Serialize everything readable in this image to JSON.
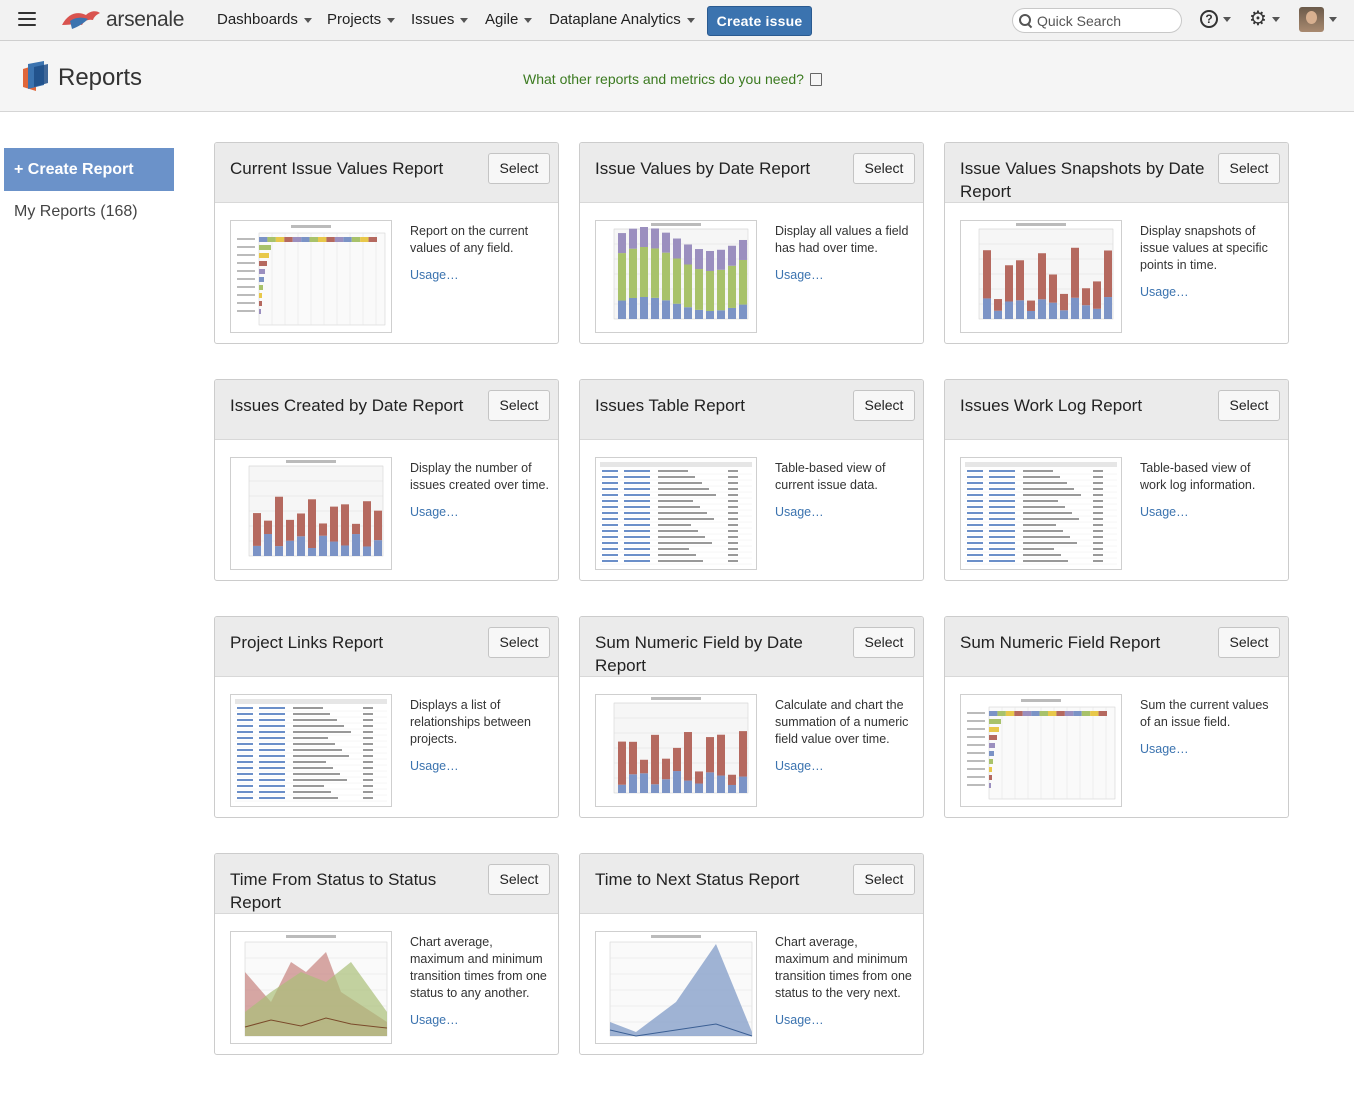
{
  "nav": {
    "brand": "arsenale",
    "items": [
      {
        "label": "Dashboards"
      },
      {
        "label": "Projects"
      },
      {
        "label": "Issues"
      },
      {
        "label": "Agile"
      },
      {
        "label": "Dataplane Analytics"
      }
    ],
    "create_issue": "Create issue",
    "search_placeholder": "Quick Search",
    "help_glyph": "?",
    "gear_glyph": "⚙"
  },
  "header": {
    "title": "Reports",
    "feedback": "What other reports and metrics do you need?"
  },
  "sidebar": {
    "create_report": "+ Create Report",
    "my_reports": "My Reports (168)"
  },
  "cards": [
    {
      "title": "Current Issue Values Report",
      "select": "Select",
      "desc": "Report on the current values of any field.",
      "usage": "Usage…",
      "thumb": "hbar-chart"
    },
    {
      "title": "Issue Values by Date Report",
      "select": "Select",
      "desc": "Display all values a field has had over time.",
      "usage": "Usage…",
      "thumb": "stacked-bar-chart"
    },
    {
      "title": "Issue Values Snapshots by Date Report",
      "select": "Select",
      "desc": "Display snapshots of issue values at specific points in time.",
      "usage": "Usage…",
      "thumb": "stacked-bar-chart"
    },
    {
      "title": "Issues Created by Date Report",
      "select": "Select",
      "desc": "Display the number of issues created over time.",
      "usage": "Usage…",
      "thumb": "stacked-bar-chart"
    },
    {
      "title": "Issues Table Report",
      "select": "Select",
      "desc": "Table-based view of current issue data.",
      "usage": "Usage…",
      "thumb": "table"
    },
    {
      "title": "Issues Work Log Report",
      "select": "Select",
      "desc": "Table-based view of work log information.",
      "usage": "Usage…",
      "thumb": "table"
    },
    {
      "title": "Project Links Report",
      "select": "Select",
      "desc": "Displays a list of relationships between projects.",
      "usage": "Usage…",
      "thumb": "table"
    },
    {
      "title": "Sum Numeric Field by Date Report",
      "select": "Select",
      "desc": "Calculate and chart the summation of a numeric field value over time.",
      "usage": "Usage…",
      "thumb": "stacked-bar-chart"
    },
    {
      "title": "Sum Numeric Field Report",
      "select": "Select",
      "desc": "Sum the current values of an issue field.",
      "usage": "Usage…",
      "thumb": "hbar-chart"
    },
    {
      "title": "Time From Status to Status Report",
      "select": "Select",
      "desc": "Chart average, maximum and minimum transition times from one status to any another.",
      "usage": "Usage…",
      "thumb": "area-chart"
    },
    {
      "title": "Time to Next Status Report",
      "select": "Select",
      "desc": "Chart average, maximum and minimum transition times from one status to the very next.",
      "usage": "Usage…",
      "thumb": "area-chart"
    }
  ],
  "colors": {
    "brand_blue": "#3b73af",
    "sidebar_button": "#6b92c9",
    "feedback_green": "#3b7a20",
    "bar_blue": "#7b93c6",
    "bar_red": "#b5695f",
    "bar_green": "#a8c26a",
    "bar_purple": "#9b8fbf"
  }
}
